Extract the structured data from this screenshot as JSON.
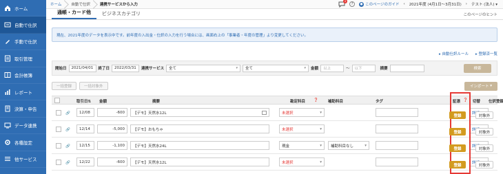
{
  "sidebar": {
    "items": [
      {
        "label": "ホーム",
        "icon": "home-icon"
      },
      {
        "label": "自動で仕訳",
        "icon": "auto-entry-icon"
      },
      {
        "label": "手動で仕訳",
        "icon": "manual-entry-icon"
      },
      {
        "label": "取引管理",
        "icon": "transaction-icon"
      },
      {
        "label": "会計帳簿",
        "icon": "ledger-icon"
      },
      {
        "label": "レポート",
        "icon": "report-icon"
      },
      {
        "label": "決算・申告",
        "icon": "settlement-icon"
      },
      {
        "label": "データ連携",
        "icon": "data-link-icon"
      },
      {
        "label": "各種設定",
        "icon": "settings-icon"
      },
      {
        "label": "他サービス",
        "icon": "services-icon"
      }
    ],
    "active_index": 1
  },
  "breadcrumb": {
    "home": "ホーム",
    "parent": "自動で仕訳",
    "current": "連携サービスから入力"
  },
  "topbar": {
    "chat_badge": "1",
    "help": "?",
    "guide_label": "このページのガイド",
    "fiscal_year": "2021年度 (4月1日〜3月31日)",
    "user": "テスト (法人)"
  },
  "tabs": [
    {
      "label": "通帳・カード他",
      "active": true
    },
    {
      "label": "ビジネスカテゴリ",
      "active": false
    }
  ],
  "page_hint": "このページのヒント",
  "notice": "現在、2021年度のデータを表示中です。前年度の入出金・仕訳の入力を行う場合には、画面右上の「事業者・年度の管理」より変更してください。",
  "links": {
    "auto_rule": "自動仕訳ルール",
    "linked_list": "登録済一覧"
  },
  "filter": {
    "start_label": "開始日",
    "start_value": "2021/04/01",
    "end_label": "終了日",
    "end_value": "2022/03/31",
    "service_label": "連携サービス",
    "service_value": "全て",
    "account_value": "全て",
    "amount_label": "金額",
    "amount_min_placeholder": "以上",
    "amount_sep": "〜",
    "amount_max_placeholder": "以下",
    "memo_label": "摘要",
    "search_button": "検索"
  },
  "actions": {
    "bulk_register": "一括登録",
    "bulk_exclude": "一括対象外",
    "import": "インポート"
  },
  "table": {
    "headers": {
      "date": "取引日",
      "amount": "金額",
      "memo": "摘要",
      "account": "勘定科目",
      "sub_account": "補助科目",
      "tag": "タグ",
      "evidence": "証憑",
      "switch": "切替",
      "register": "仕訳登録"
    },
    "rows": [
      {
        "date": "12/08",
        "amount": "-600",
        "memo": "【デモ】天然水12L",
        "account": "未選択",
        "account_unselected": true,
        "sub_account": ""
      },
      {
        "date": "12/14",
        "amount": "-5,000",
        "memo": "【デモ】おもちゃ",
        "account": "未選択",
        "account_unselected": true,
        "sub_account": ""
      },
      {
        "date": "12/15",
        "amount": "-1,100",
        "memo": "【デモ】天然水24L",
        "account": "現金",
        "account_unselected": false,
        "sub_account": "補助科目なし"
      },
      {
        "date": "12/22",
        "amount": "-600",
        "memo": "【デモ】天然水12L",
        "account": "未選択",
        "account_unselected": true,
        "sub_account": ""
      }
    ],
    "detail_label": "詳細",
    "register_label": "登録",
    "exclude_label": "対象外"
  },
  "colors": {
    "sidebar": "#2f6db3",
    "accent": "#2f6db3",
    "register": "#d39b20",
    "highlight": "#e53935"
  }
}
